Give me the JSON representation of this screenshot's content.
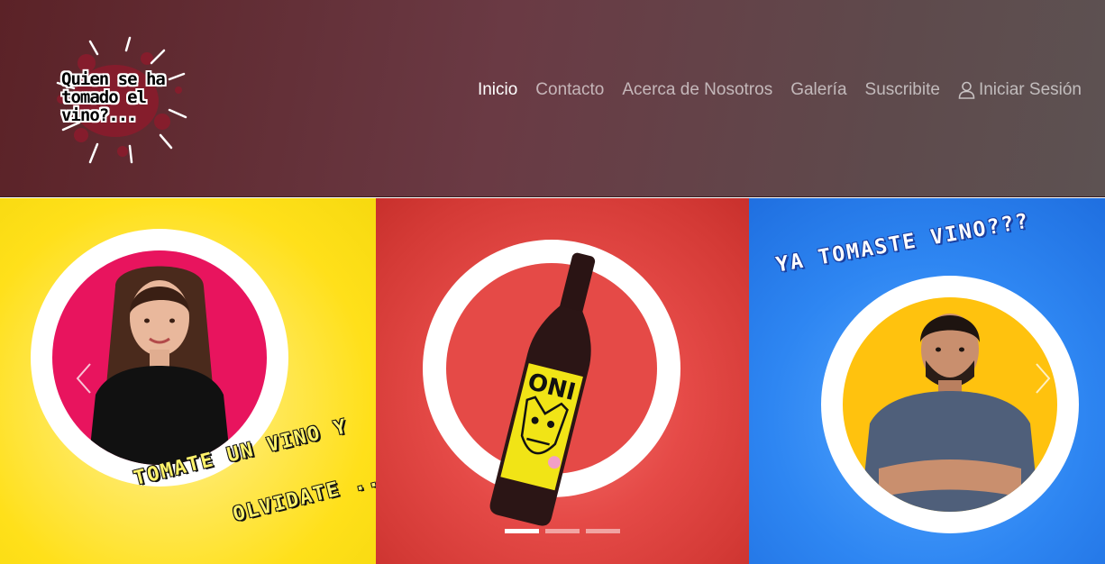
{
  "header": {
    "logo": {
      "line1": "Quien se ha",
      "line2": "tomado el",
      "line3": "vino?..."
    }
  },
  "nav": {
    "items": [
      {
        "label": "Inicio",
        "active": true
      },
      {
        "label": "Contacto"
      },
      {
        "label": "Acerca de Nosotros"
      },
      {
        "label": "Galería"
      },
      {
        "label": "Suscribite"
      }
    ],
    "login": {
      "label": "Iniciar Sesión",
      "icon": "user-icon"
    }
  },
  "carousel": {
    "slides": [
      {
        "caption_line1": "TOMATE UN VINO Y",
        "caption_line2": "OLVIDATE ...",
        "background": "#ffe01a",
        "circle_color": "#e8145e"
      },
      {
        "background": "#e54a47",
        "circle_color": "#e54a47",
        "bottle_label": "ONI"
      },
      {
        "caption": "YA TOMASTE VINO???",
        "background": "#2e86f2",
        "circle_color": "#ffc20e"
      }
    ],
    "indicators_count": 3,
    "active_indicator": 0,
    "prev_icon": "chevron-left-icon",
    "next_icon": "chevron-right-icon"
  },
  "colors": {
    "header_bg": "#5b2227",
    "nav_active": "#ffffff",
    "nav_inactive": "#c8b5b7"
  }
}
